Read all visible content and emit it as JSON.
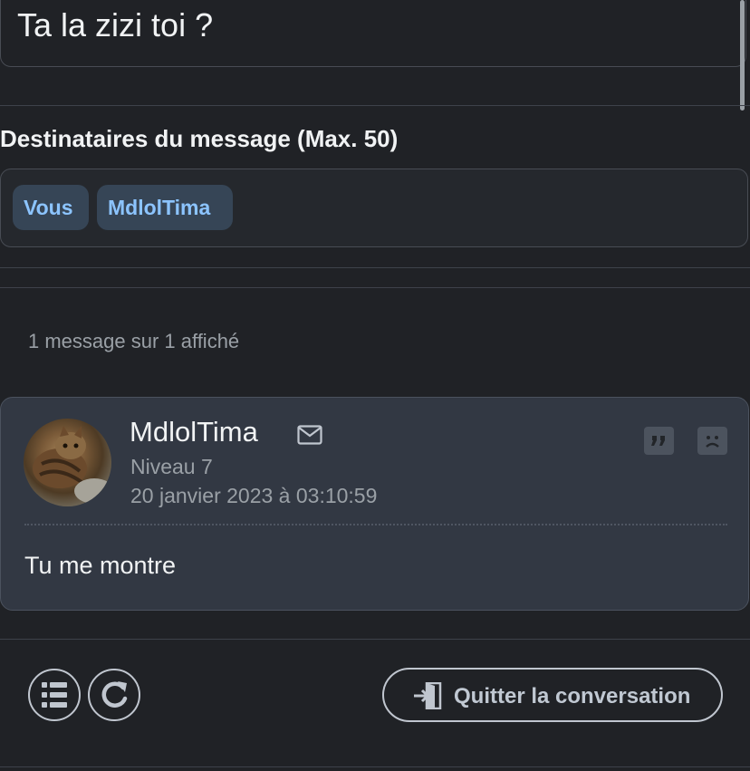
{
  "conversation": {
    "title": "Ta la zizi toi ?"
  },
  "recipients": {
    "label": "Destinataires du message (Max. 50)",
    "chips": [
      "Vous",
      "MdlolTima"
    ]
  },
  "messages_count": "1 message sur 1 affiché",
  "message": {
    "author": "MdlolTima",
    "level": "Niveau 7",
    "date": "20 janvier 2023 à 03:10:59",
    "body": "Tu me montre"
  },
  "footer": {
    "quit_label": "Quitter la conversation",
    "icons": [
      "list-icon",
      "refresh-icon",
      "exit-icon"
    ]
  }
}
